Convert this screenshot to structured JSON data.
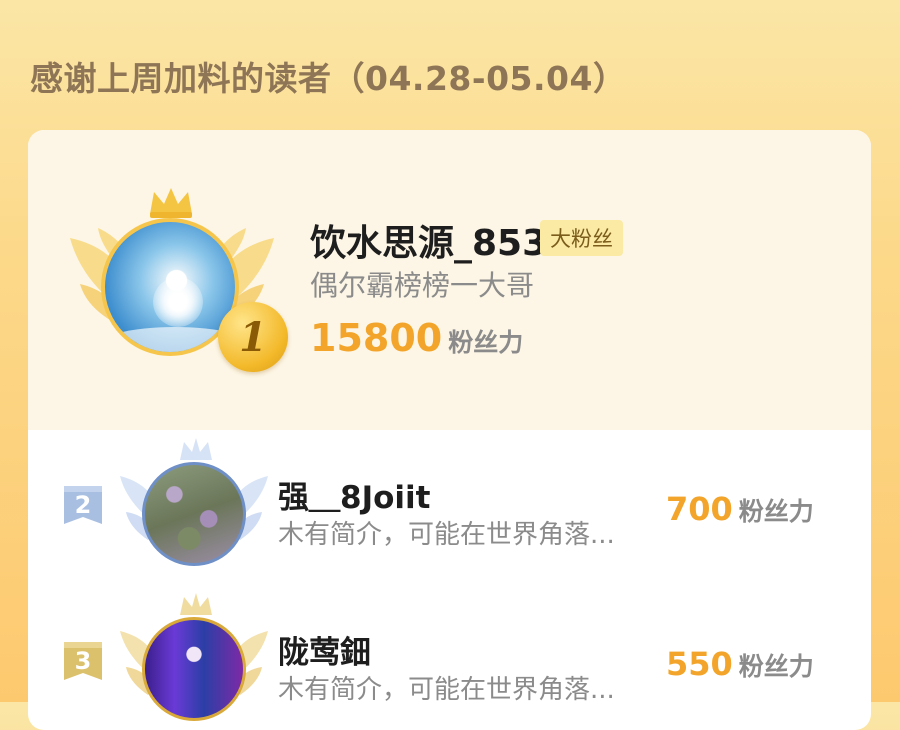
{
  "header": {
    "title": "感谢上周加料的读者（04.28-05.04）"
  },
  "leaders": [
    {
      "rank": "1",
      "name": "饮水思源_853",
      "badge": "大粉丝",
      "bio": "偶尔霸榜榜一大哥",
      "score": "15800",
      "score_unit": "粉丝力"
    },
    {
      "rank": "2",
      "name": "强＿8Joiit",
      "bio": "木有简介，可能在世界角落...",
      "score": "700",
      "score_unit": "粉丝力"
    },
    {
      "rank": "3",
      "name": "陇莺鈿",
      "bio": "木有简介，可能在世界角落...",
      "score": "550",
      "score_unit": "粉丝力"
    }
  ],
  "colors": {
    "accent_score": "#f2a52a",
    "gold": "#f5c64b",
    "silver": "#9fb6da",
    "bronze": "#d9b95a"
  },
  "icons": [
    "crown-icon",
    "wings-icon",
    "rank-1-medal-icon",
    "rank-2-flag-icon",
    "rank-3-flag-icon"
  ]
}
